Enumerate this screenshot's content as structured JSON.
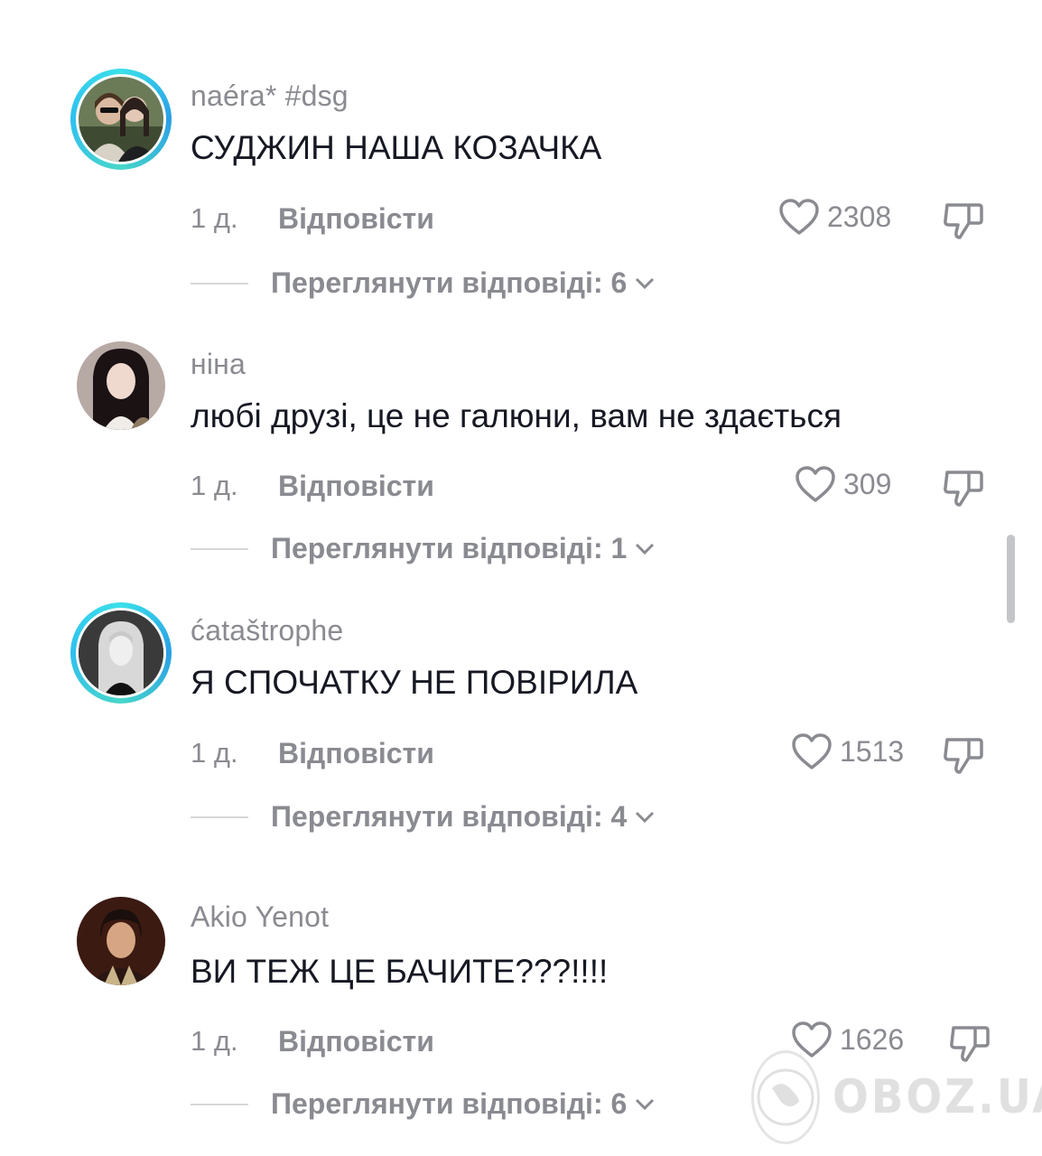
{
  "comments": [
    {
      "username": "naéra* #dsg",
      "text": "СУДЖИН НАША КОЗАЧКА",
      "time": "1 д.",
      "reply_label": "Відповісти",
      "likes": "2308",
      "view_replies": "Переглянути відповіді: 6",
      "story_ring": true
    },
    {
      "username": "ніна",
      "text": "любі друзі, це не галюни, вам не здається",
      "time": "1 д.",
      "reply_label": "Відповісти",
      "likes": "309",
      "view_replies": "Переглянути відповіді: 1",
      "story_ring": false
    },
    {
      "username": "ćataštrophe",
      "text": "Я СПОЧАТКУ НЕ ПОВІРИЛА",
      "time": "1 д.",
      "reply_label": "Відповісти",
      "likes": "1513",
      "view_replies": "Переглянути відповіді: 4",
      "story_ring": true
    },
    {
      "username": "Akio Yenot",
      "text": "ВИ ТЕЖ ЦЕ БАЧИТЕ???!!!!",
      "time": "1 д.",
      "reply_label": "Відповісти",
      "likes": "1626",
      "view_replies": "Переглянути відповіді: 6",
      "story_ring": false
    }
  ],
  "icons": {
    "like": "heart-outline-icon",
    "dislike": "thumbs-down-icon",
    "expand": "chevron-down-icon"
  },
  "colors": {
    "text_primary": "#161823",
    "text_secondary": "#8a8b91",
    "story_ring": "#3be0e9"
  },
  "watermark": "OBOZ.UA"
}
